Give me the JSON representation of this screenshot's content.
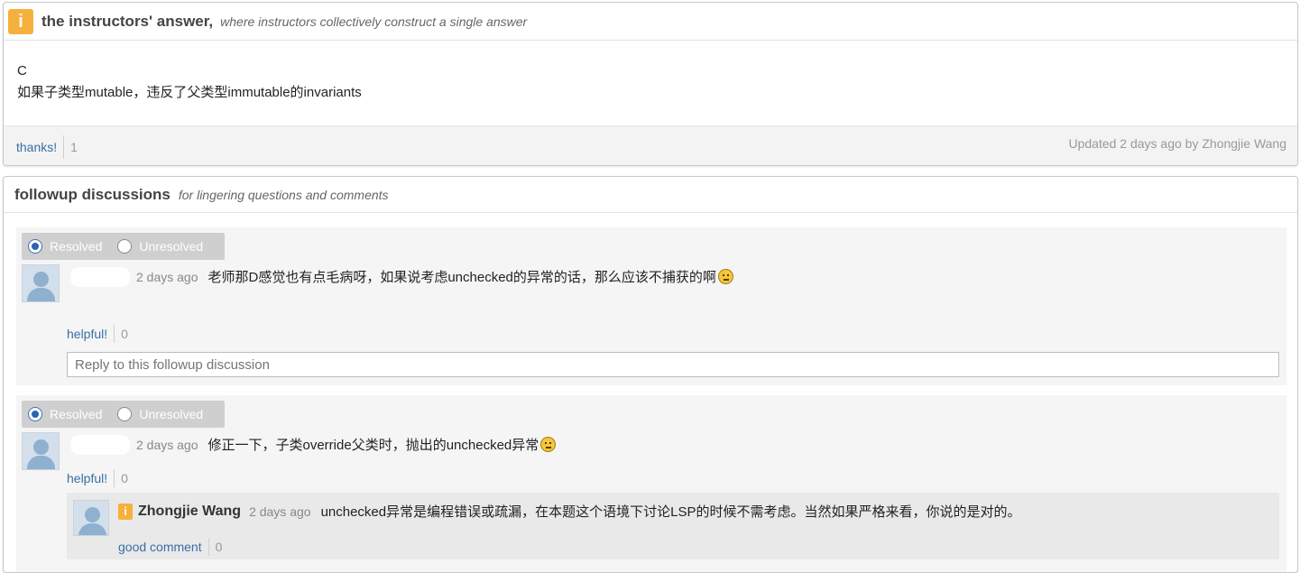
{
  "answer": {
    "header_title": "the instructors' answer,",
    "header_subtitle": "where instructors collectively construct a single answer",
    "body_lines": [
      "C",
      "如果子类型mutable，违反了父类型immutable的invariants"
    ],
    "thanks_label": "thanks!",
    "thanks_count": "1",
    "updated_text": "Updated 2 days ago by Zhongjie Wang"
  },
  "followup": {
    "header_title": "followup discussions",
    "header_subtitle": "for lingering questions and comments",
    "threads": [
      {
        "resolved_label": "Resolved",
        "unresolved_label": "Unresolved",
        "status": "resolved",
        "time": "2 days ago",
        "message": "老师那D感觉也有点毛病呀，如果说考虑unchecked的异常的话，那么应该不捕获的啊",
        "helpful_label": "helpful!",
        "helpful_count": "0",
        "reply_placeholder": "Reply to this followup discussion"
      },
      {
        "resolved_label": "Resolved",
        "unresolved_label": "Unresolved",
        "status": "resolved",
        "time": "2 days ago",
        "message": "修正一下，子类override父类时，抛出的unchecked异常",
        "helpful_label": "helpful!",
        "helpful_count": "0",
        "reply": {
          "badge": "i",
          "author": "Zhongjie Wang",
          "time": "2 days ago",
          "message": "unchecked异常是编程错误或疏漏，在本题这个语境下讨论LSP的时候不需考虑。当然如果严格来看，你说的是对的。",
          "good_label": "good comment",
          "good_count": "0"
        }
      }
    ]
  },
  "icons": {
    "instructor_badge": "i",
    "thread_1_emoji": "thinking-face-icon",
    "thread_2_emoji": "smiling-face-icon"
  },
  "colors": {
    "instructor_badge": "#f6b13c",
    "link": "#3a6ea5",
    "resolved_radio": "#2a63b0"
  }
}
